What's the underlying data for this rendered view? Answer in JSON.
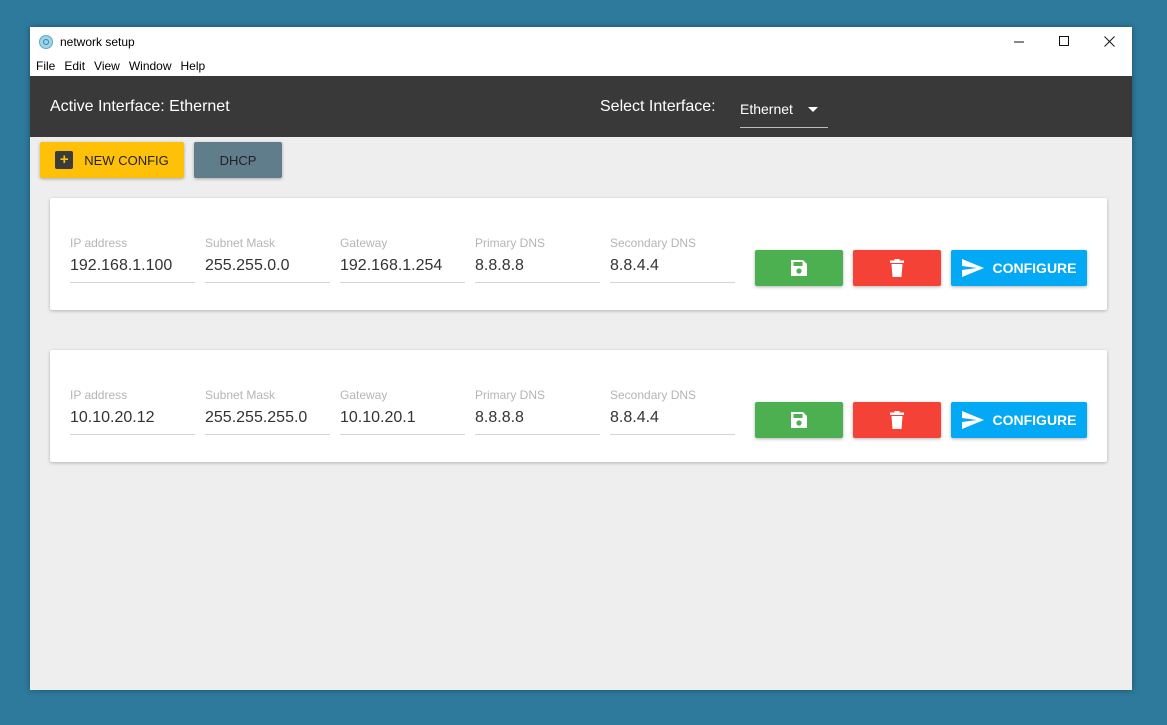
{
  "window": {
    "title": "network setup",
    "controls": {
      "minimize": "—",
      "maximize": "☐",
      "close": "✕"
    }
  },
  "menu": [
    "File",
    "Edit",
    "View",
    "Window",
    "Help"
  ],
  "header": {
    "active_interface": "Active Interface: Ethernet",
    "select_label": "Select Interface:",
    "selected_interface": "Ethernet"
  },
  "toolbar": {
    "new_config": "NEW CONFIG",
    "dhcp": "DHCP"
  },
  "configs": [
    {
      "fields": [
        {
          "label": "IP address",
          "value": "192.168.1.100"
        },
        {
          "label": "Subnet Mask",
          "value": "255.255.0.0"
        },
        {
          "label": "Gateway",
          "value": "192.168.1.254"
        },
        {
          "label": "Primary DNS",
          "value": "8.8.8.8"
        },
        {
          "label": "Secondary DNS",
          "value": "8.8.4.4"
        }
      ],
      "configure_label": "CONFIGURE"
    },
    {
      "fields": [
        {
          "label": "IP address",
          "value": "10.10.20.12"
        },
        {
          "label": "Subnet Mask",
          "value": "255.255.255.0"
        },
        {
          "label": "Gateway",
          "value": "10.10.20.1"
        },
        {
          "label": "Primary DNS",
          "value": "8.8.8.8"
        },
        {
          "label": "Secondary DNS",
          "value": "8.8.4.4"
        }
      ],
      "configure_label": "CONFIGURE"
    }
  ],
  "icons": {
    "save": "save-icon",
    "delete": "trash-icon",
    "configure": "send-icon",
    "new": "plus-icon"
  },
  "colors": {
    "save": "#4caf50",
    "delete": "#f44336",
    "configure": "#03a9f4",
    "new_config": "#ffc107",
    "dhcp": "#607d8b"
  }
}
